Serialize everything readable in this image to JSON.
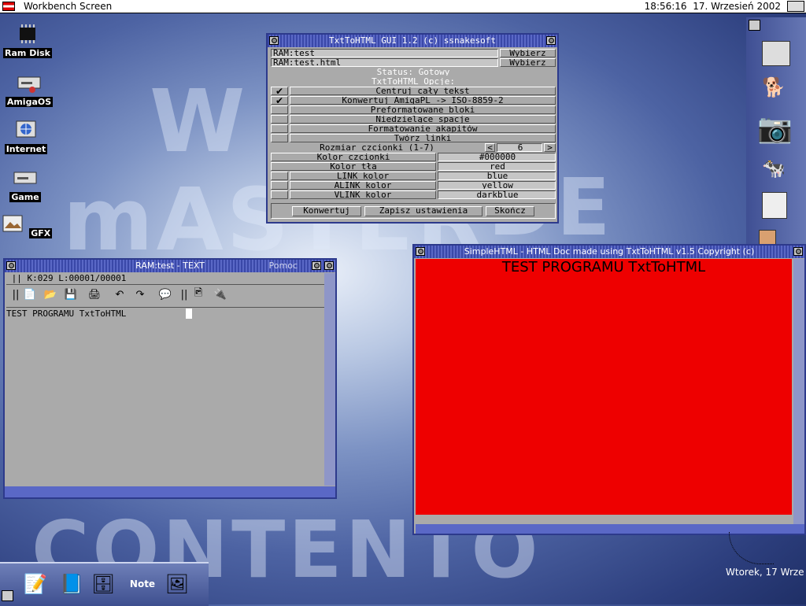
{
  "screen": {
    "title": "Workbench Screen",
    "time": "18:56:16",
    "date": "17. Wrzesień 2002"
  },
  "desktop_icons": [
    "Ram Disk",
    "AmigaOS",
    "Internet",
    "Game",
    "GFX"
  ],
  "gui": {
    "title": "TxtToHTML GUI 1.2  (c) ssnakesoft",
    "input_file": "RAM:test",
    "output_file": "RAM:test.html",
    "choose_label": "Wybierz",
    "status": "Status: Gotowy",
    "options_header": "TxtToHTML Opcje:",
    "options": [
      {
        "label": "Centruj cały tekst",
        "checked": true
      },
      {
        "label": "Konwertuj AmigaPL -> ISO-8859-2",
        "checked": true
      },
      {
        "label": "Preformatowane bloki",
        "checked": false
      },
      {
        "label": "Niedzielące spacje",
        "checked": false
      },
      {
        "label": "Formatowanie akapitów",
        "checked": false
      },
      {
        "label": "Twórz linki",
        "checked": false
      }
    ],
    "font_size_label": "Rozmiar czcionki (1-7)",
    "font_size_value": "6",
    "colors": [
      {
        "label": "Kolor czcionki",
        "value": "#000000"
      },
      {
        "label": "Kolor tła",
        "value": "red"
      },
      {
        "label": "LINK kolor",
        "value": "blue"
      },
      {
        "label": "ALINK kolor",
        "value": "yellow"
      },
      {
        "label": "VLINK kolor",
        "value": "darkblue"
      }
    ],
    "buttons": {
      "convert": "Konwertuj",
      "save": "Zapisz ustawienia",
      "quit": "Skończ"
    },
    "check_symbol": "✔"
  },
  "editor": {
    "title": "RAM:test - TEXT",
    "help_label": "Pomoc",
    "status": "K:029 L:00001/00001",
    "content": "TEST PROGRAMU TxtToHTML"
  },
  "browser": {
    "title": "SimpleHTML - HTML Doc made using TxtToHTML v1.5 Copyright (c)",
    "content": "TEST PROGRAMU TxtToHTML",
    "bg_color": "#ee0000"
  },
  "clock_widget": {
    "label": "Wtorek, 17 Wrze"
  },
  "dock": {
    "note_label": "Note"
  }
}
